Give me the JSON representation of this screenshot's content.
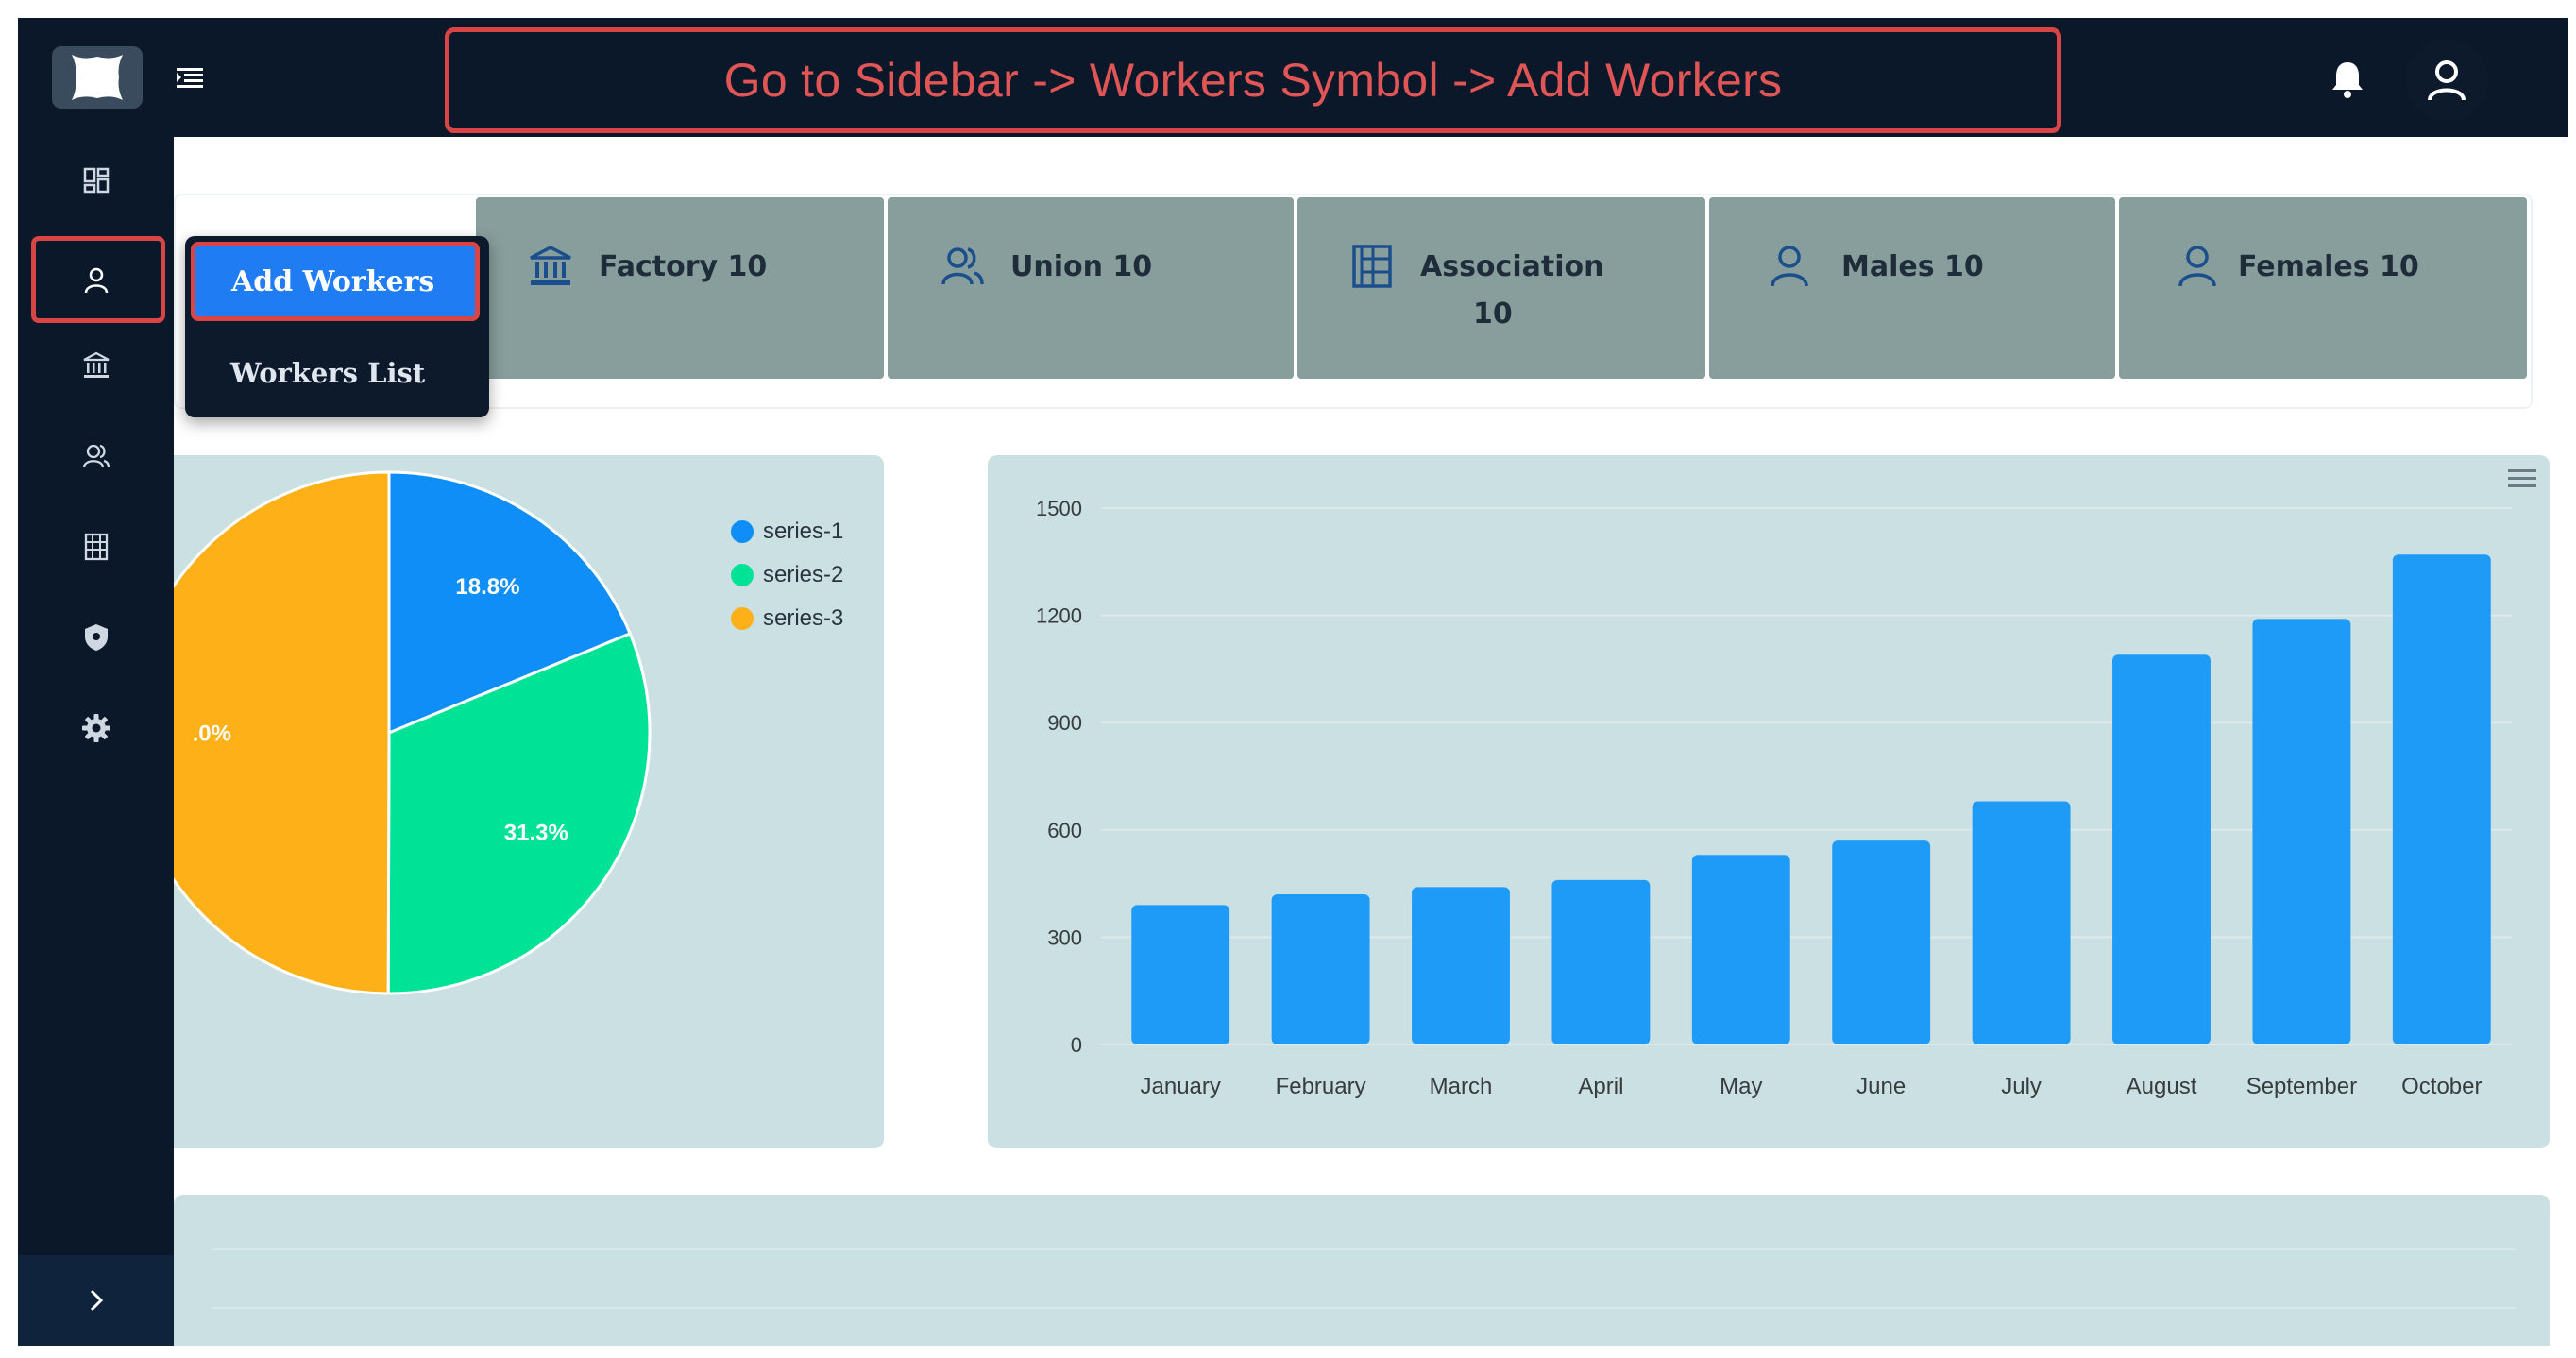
{
  "banner": {
    "text": "Go to Sidebar -> Workers Symbol -> Add Workers"
  },
  "stats": [
    {
      "label": "Factory 10",
      "icon": "bank-icon"
    },
    {
      "label": "Union 10",
      "icon": "users-icon"
    },
    {
      "label": "Association",
      "label2": "10",
      "icon": "building-grid-icon"
    },
    {
      "label": "Males 10",
      "icon": "user-icon"
    },
    {
      "label": "Females 10",
      "icon": "user-icon"
    }
  ],
  "dropdown": {
    "active_item": "Add Workers",
    "item": "Workers List"
  },
  "sidebar": {
    "icons": [
      "dashboard-icon",
      "user-icon",
      "bank-icon",
      "users-icon",
      "building-grid-icon",
      "shield-icon",
      "gear-icon"
    ]
  },
  "colors": {
    "pie_series1": "#0f8ef7",
    "pie_series2": "#00e396",
    "pie_series3": "#feb019",
    "bar": "#1e9af7"
  },
  "pie_chart": {
    "type": "pie",
    "legend": [
      "series-1",
      "series-2",
      "series-3"
    ],
    "values": [
      18.8,
      31.3,
      50.0
    ],
    "labels": [
      "18.8%",
      "31.3%",
      ".0%"
    ],
    "legend_position": "top-right"
  },
  "chart_data": {
    "type": "bar",
    "categories": [
      "January",
      "February",
      "March",
      "April",
      "May",
      "June",
      "July",
      "August",
      "September",
      "October"
    ],
    "values": [
      390,
      420,
      440,
      460,
      530,
      570,
      680,
      1090,
      1190,
      1370
    ],
    "ylim": [
      0,
      1500
    ],
    "yticks": [
      "1500",
      "1200",
      "900",
      "600",
      "300",
      "0"
    ],
    "grid": true
  }
}
